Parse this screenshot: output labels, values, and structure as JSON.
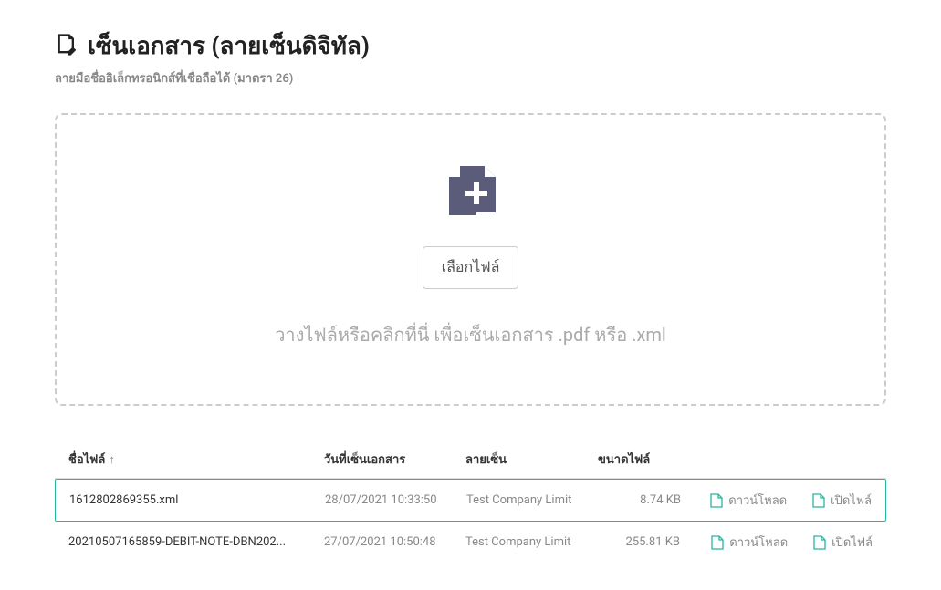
{
  "header": {
    "title": "เซ็นเอกสาร (ลายเซ็นดิจิทัล)",
    "subtitle": "ลายมือชื่ออิเล็กทรอนิกส์ที่เชื่อถือได้ (มาตรา 26)"
  },
  "dropzone": {
    "choose_file_label": "เลือกไฟล์",
    "hint": "วางไฟล์หรือคลิกที่นี่ เพื่อเซ็นเอกสาร .pdf หรือ .xml"
  },
  "table": {
    "columns": {
      "filename": "ชื่อไฟล์",
      "date": "วันที่เซ็นเอกสาร",
      "signature": "ลายเซ็น",
      "size": "ขนาดไฟล์"
    },
    "sort_indicator": "↑",
    "actions": {
      "download": "ดาวน์โหลด",
      "open": "เปิดไฟล์"
    },
    "rows": [
      {
        "filename": "1612802869355.xml",
        "date": "28/07/2021 10:33:50",
        "signature": "Test Company Limit",
        "size": "8.74 KB",
        "highlighted": true
      },
      {
        "filename": "20210507165859-DEBIT-NOTE-DBN202...",
        "date": "27/07/2021 10:50:48",
        "signature": "Test Company Limit",
        "size": "255.81 KB",
        "highlighted": false
      }
    ]
  }
}
